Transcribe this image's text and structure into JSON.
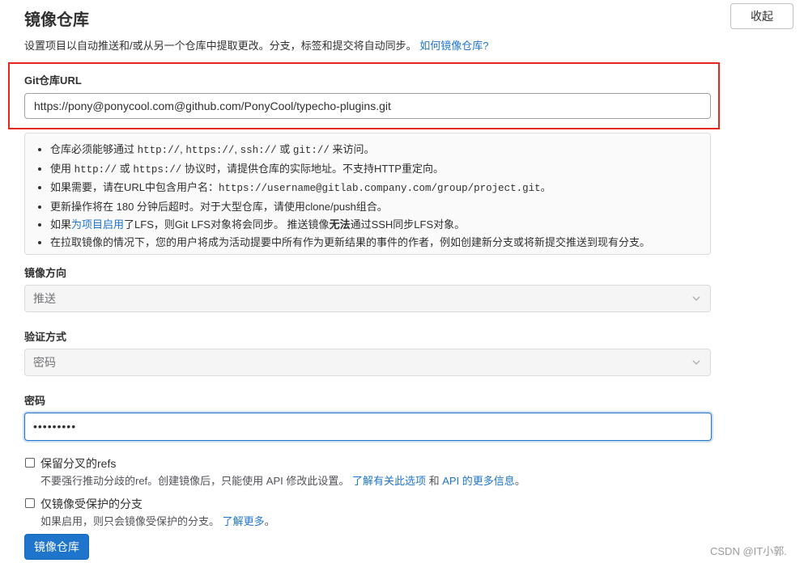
{
  "header": {
    "title": "镜像仓库",
    "collapse_label": "收起",
    "subtitle": "设置项目以自动推送和/或从另一个仓库中提取更改。分支，标签和提交将自动同步。",
    "subtitle_link": "如何镜像仓库?"
  },
  "url_field": {
    "label": "Git仓库URL",
    "value": "https://pony@ponycool.com@github.com/PonyCool/typecho-plugins.git"
  },
  "info": {
    "l1_a": "仓库必须能够通过 ",
    "l1_c1": "http://",
    "l1_s1": ", ",
    "l1_c2": "https://",
    "l1_s2": ", ",
    "l1_c3": "ssh://",
    "l1_s3": " 或 ",
    "l1_c4": "git://",
    "l1_b": " 来访问。",
    "l2_a": "使用 ",
    "l2_c1": "http://",
    "l2_s1": " 或 ",
    "l2_c2": "https://",
    "l2_b": " 协议时，请提供仓库的实际地址。不支持HTTP重定向。",
    "l3_a": "如果需要，请在URL中包含用户名：",
    "l3_c": "https://username@gitlab.company.com/group/project.git",
    "l3_b": "。",
    "l4": "更新操作将在 180 分钟后超时。对于大型仓库，请使用clone/push组合。",
    "l5_a": "如果",
    "l5_link": "为项目启用",
    "l5_b": "了LFS，则Git LFS对象将会同步。 推送镜像",
    "l5_bold": "无法",
    "l5_c": "通过SSH同步LFS对象。",
    "l6": "在拉取镜像的情况下，您的用户将成为活动提要中所有作为更新结果的事件的作者，例如创建新分支或将新提交推送到现有分支。"
  },
  "direction": {
    "label": "镜像方向",
    "value": "推送"
  },
  "auth": {
    "label": "验证方式",
    "value": "密码"
  },
  "password": {
    "label": "密码",
    "value": "•••••••••"
  },
  "keep_refs": {
    "label": "保留分叉的refs",
    "help": "不要强行推动分歧的ref。创建镜像后，只能使用 API 修改此设置。",
    "link1": "了解有关此选项",
    "and": " 和 ",
    "link2": "API 的更多信息",
    "end": "。"
  },
  "protected": {
    "label": "仅镜像受保护的分支",
    "help": "如果启用，则只会镜像受保护的分支。",
    "link": "了解更多",
    "end": "。"
  },
  "submit_label": "镜像仓库",
  "watermark": "CSDN @IT小郭."
}
